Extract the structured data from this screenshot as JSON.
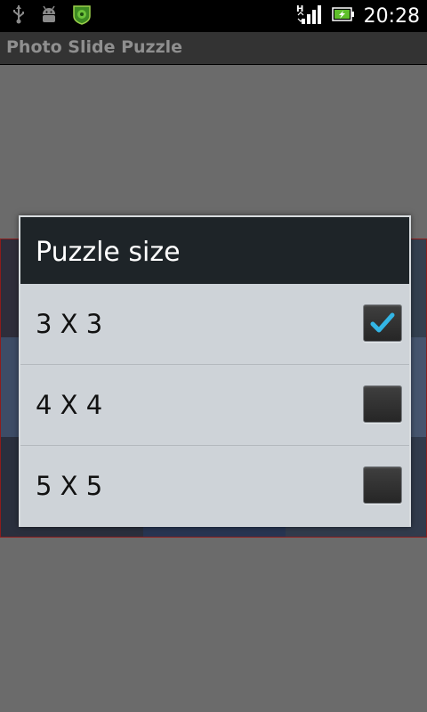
{
  "status_bar": {
    "time": "20:28",
    "icons": [
      "usb-icon",
      "android-debug-icon",
      "app-notification-icon",
      "hspa-signal-icon",
      "battery-charging-icon"
    ]
  },
  "app": {
    "title": "Photo Slide Puzzle"
  },
  "dialog": {
    "title": "Puzzle size",
    "options": [
      {
        "label": "3 X 3",
        "checked": true
      },
      {
        "label": "4 X 4",
        "checked": false
      },
      {
        "label": "5 X 5",
        "checked": false
      }
    ]
  },
  "colors": {
    "check_accent": "#33b5e5",
    "dialog_header": "#1e2428",
    "dialog_body": "#ced3d8",
    "dim_background": "#6b6b6b"
  }
}
